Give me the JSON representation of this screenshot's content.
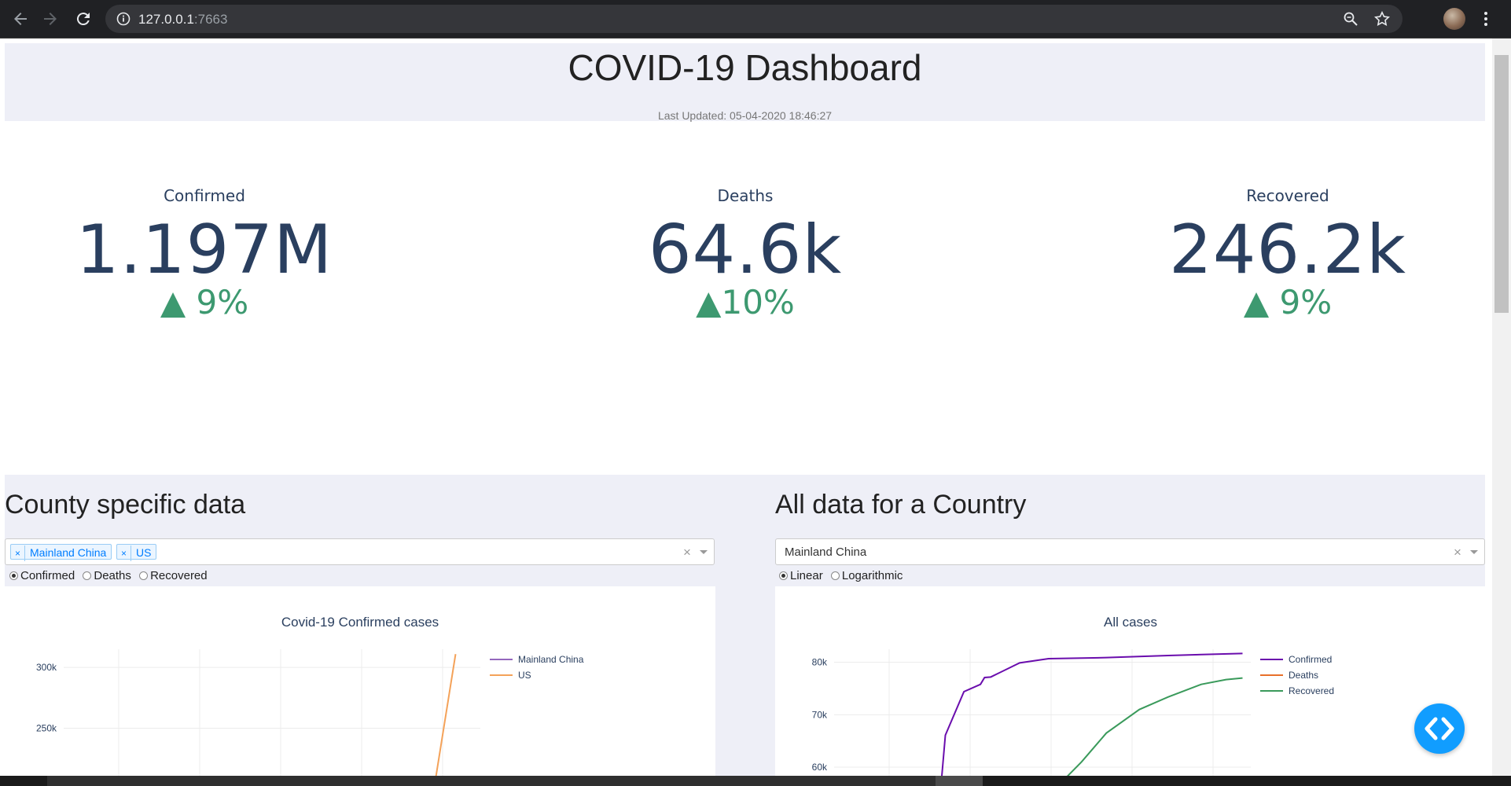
{
  "browser": {
    "url_host": "127.0.0.1",
    "url_port": ":7663"
  },
  "header": {
    "title": "COVID-19 Dashboard",
    "last_updated": "Last Updated: 05-04-2020 18:46:27"
  },
  "kpis": [
    {
      "label": "Confirmed",
      "value": "1.197M",
      "delta": "▲ 9%"
    },
    {
      "label": "Deaths",
      "value": "64.6k",
      "delta": "▲10%"
    },
    {
      "label": "Recovered",
      "value": "246.2k",
      "delta": "▲ 9%"
    }
  ],
  "left_panel": {
    "title": "County specific data",
    "selected_countries": [
      "Mainland China",
      "US"
    ],
    "radio_options": [
      {
        "label": "Confirmed",
        "checked": true
      },
      {
        "label": "Deaths",
        "checked": false
      },
      {
        "label": "Recovered",
        "checked": false
      }
    ],
    "chart_title": "Covid-19 Confirmed cases"
  },
  "right_panel": {
    "title": "All data for a Country",
    "selected_country": "Mainland China",
    "radio_options": [
      {
        "label": "Linear",
        "checked": true
      },
      {
        "label": "Logarithmic",
        "checked": false
      }
    ],
    "chart_title": "All cases"
  },
  "dropdown": {
    "clear_glyph": "×",
    "tag_remove_glyph": "×"
  },
  "chart_data": [
    {
      "type": "line",
      "title": "Covid-19 Confirmed cases",
      "y_ticks": [
        "300k",
        "250k"
      ],
      "ylim": [
        205000,
        315000
      ],
      "x_range": [
        0,
        10
      ],
      "series": [
        {
          "name": "Mainland China",
          "color": "#9467bd",
          "x": [],
          "y": []
        },
        {
          "name": "US",
          "color": "#f4a259",
          "x": [
            8.9,
            9.4
          ],
          "y": [
            205000,
            311000
          ]
        }
      ],
      "legend": "top-right",
      "grid": true
    },
    {
      "type": "line",
      "title": "All cases",
      "y_ticks": [
        "80k",
        "70k",
        "60k"
      ],
      "ylim": [
        57000,
        82500
      ],
      "x_range": [
        0,
        10
      ],
      "series": [
        {
          "name": "Confirmed",
          "color": "#6a0dad",
          "x": [
            2.5,
            2.6,
            3.05,
            3.45,
            3.55,
            3.7,
            4.4,
            5.1,
            6.5,
            8.0,
            9.8
          ],
          "y": [
            57000,
            66100,
            74400,
            75800,
            77100,
            77200,
            79900,
            80700,
            80900,
            81300,
            81700
          ]
        },
        {
          "name": "Deaths",
          "color": "#e8702a",
          "x": [],
          "y": []
        },
        {
          "name": "Recovered",
          "color": "#3a9a5b",
          "x": [
            5.4,
            5.9,
            6.5,
            7.3,
            8.0,
            8.8,
            9.4,
            9.8
          ],
          "y": [
            57000,
            61000,
            66500,
            71000,
            73400,
            75800,
            76700,
            77000
          ]
        }
      ],
      "legend": "top-right",
      "grid": true
    }
  ]
}
